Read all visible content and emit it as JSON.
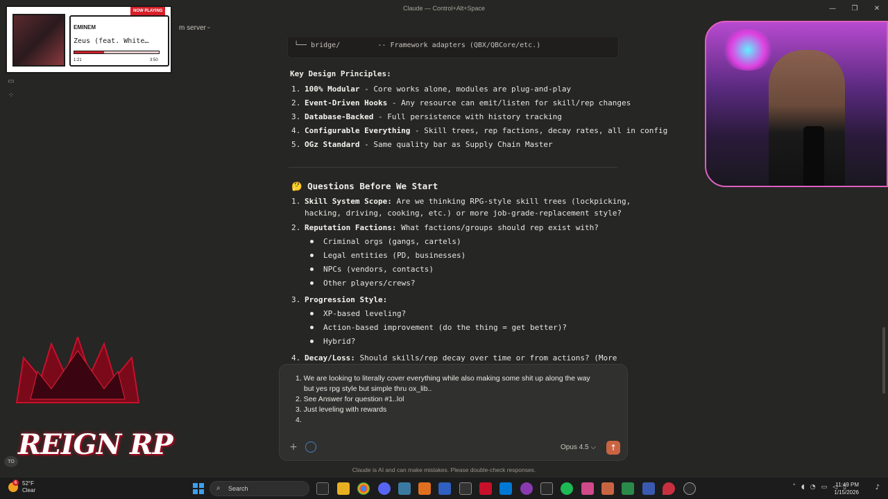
{
  "window": {
    "title": "Claude — Control+Alt+Space",
    "server_label": "m server"
  },
  "code": {
    "line": "└── bridge/         -- Framework adapters (QBX/QBCore/etc.)"
  },
  "principles": {
    "heading": "Key Design Principles:",
    "items": [
      {
        "num": "1.",
        "bold": "100% Modular",
        "text": " - Core works alone, modules are plug-and-play"
      },
      {
        "num": "2.",
        "bold": "Event-Driven Hooks",
        "text": " - Any resource can emit/listen for skill/rep changes"
      },
      {
        "num": "3.",
        "bold": "Database-Backed",
        "text": " - Full persistence with history tracking"
      },
      {
        "num": "4.",
        "bold": "Configurable Everything",
        "text": " - Skill trees, rep factions, decay rates, all in config"
      },
      {
        "num": "5.",
        "bold": "OGz Standard",
        "text": " - Same quality bar as Supply Chain Master"
      }
    ]
  },
  "questions": {
    "heading": "🤔 Questions Before We Start",
    "q1": {
      "num": "1.",
      "bold": "Skill System Scope:",
      "text": " Are we thinking RPG-style skill trees (lockpicking,",
      "cont": "hacking, driving, cooking, etc.) or more job-grade-replacement style?"
    },
    "q2": {
      "num": "2.",
      "bold": "Reputation Factions:",
      "text": " What factions/groups should rep exist with?"
    },
    "q2_bullets": [
      "Criminal orgs (gangs, cartels)",
      "Legal entities (PD, businesses)",
      "NPCs (vendors, contacts)",
      "Other players/crews?"
    ],
    "q3": {
      "num": "3.",
      "bold": "Progression Style:",
      "text": ""
    },
    "q3_bullets": [
      "XP-based leveling?",
      "Action-based improvement (do the thing = get better)?",
      "Hybrid?"
    ],
    "q4": {
      "num": "4.",
      "bold": "Decay/Loss:",
      "text": " Should skills/rep decay over time or from actions? (More"
    }
  },
  "composer": {
    "lines": [
      "1. We are looking to literally cover everything while also making some shit up along the way",
      "but yes rpg style but simple thru ox_lib..",
      "2. See Answer for question #1..lol",
      "3. Just leveling with rewards",
      "4."
    ],
    "model": "Opus 4.5",
    "model_chevron": "⌵",
    "plus": "+",
    "send": "↑"
  },
  "disclaimer": "Claude is AI and can make mistakes. Please double-check responses.",
  "now_playing": {
    "badge": "NOW PLAYING",
    "artist": "EMINEM",
    "song": "Zeus (feat. White…",
    "elapsed": "1:21",
    "duration": "3:50",
    "progress": 0.35
  },
  "overlay": {
    "brand": "REIGN RP",
    "badge": "TO"
  },
  "taskbar": {
    "weather_badge": "6",
    "temp": "52°F",
    "condition": "Clear",
    "search": "Search",
    "time": "11:49 PM",
    "date": "1/15/2026"
  }
}
